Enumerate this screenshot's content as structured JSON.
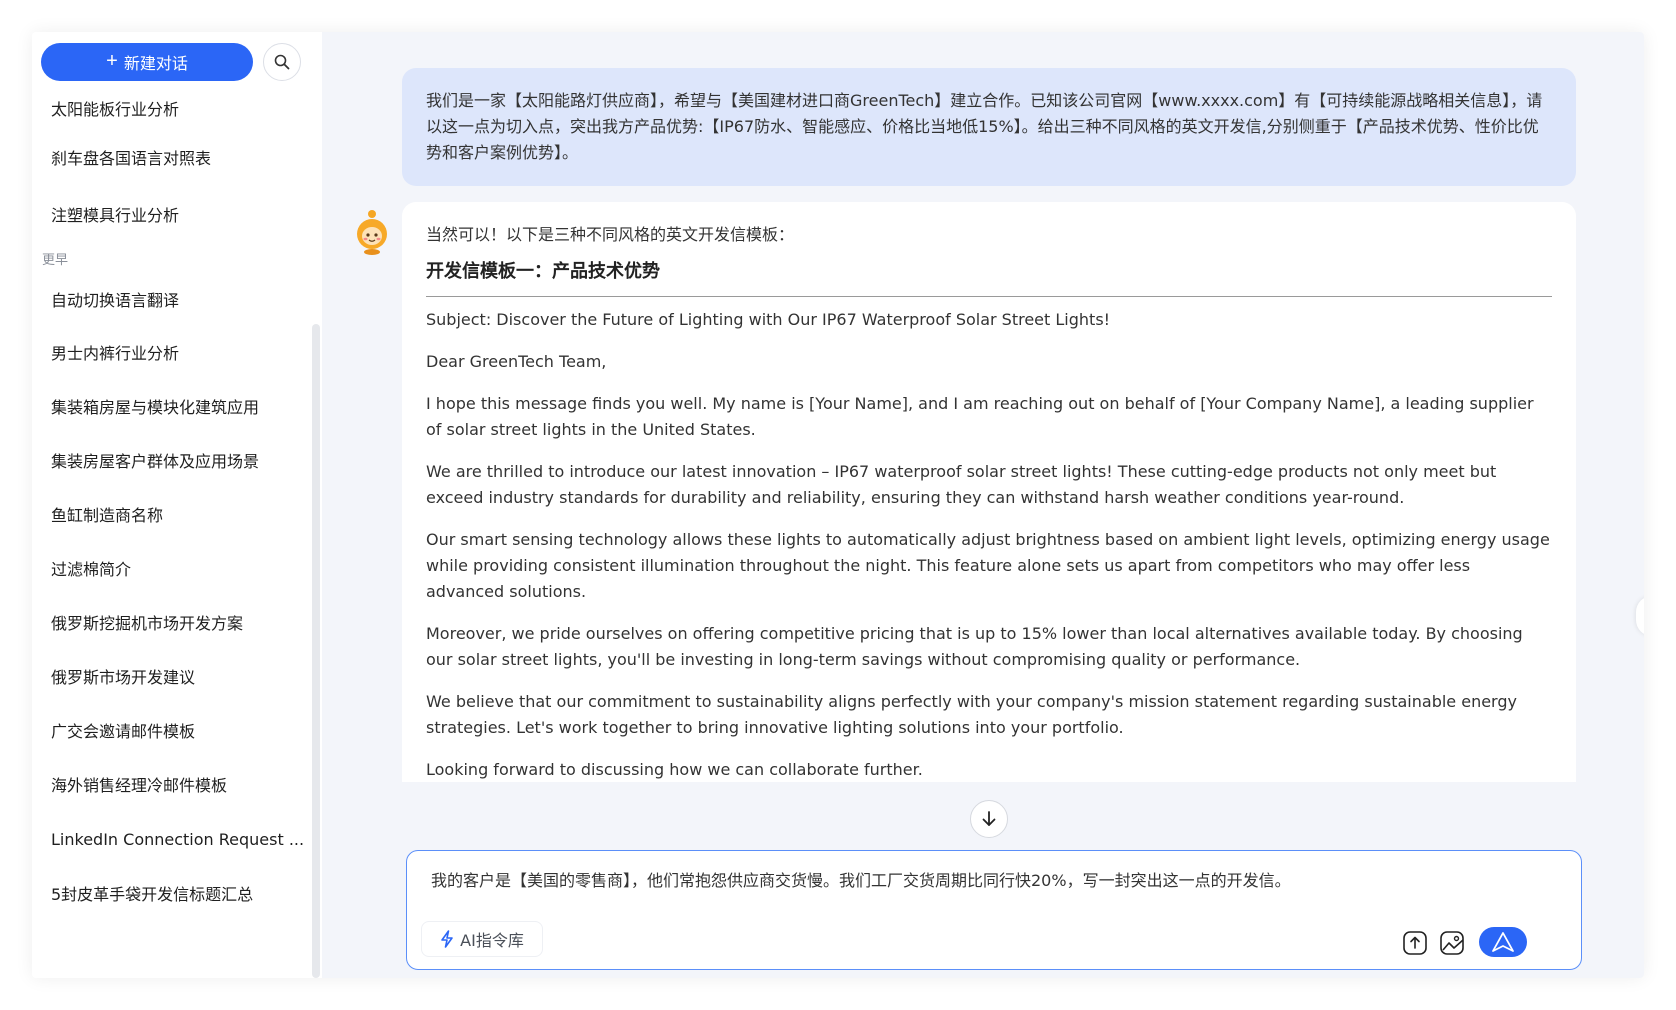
{
  "sidebar": {
    "new_chat_label": "新建对话",
    "recent_items": [
      "太阳能板行业分析",
      "刹车盘各国语言对照表",
      "注塑模具行业分析"
    ],
    "group_label": "更早",
    "older_items": [
      "自动切换语言翻译",
      "男士内裤行业分析",
      "集装箱房屋与模块化建筑应用",
      "集装房屋客户群体及应用场景",
      "鱼缸制造商名称",
      "过滤棉简介",
      "俄罗斯挖掘机市场开发方案",
      "俄罗斯市场开发建议",
      "广交会邀请邮件模板",
      "海外销售经理冷邮件模板",
      "LinkedIn Connection Request ...",
      "5封皮革手袋开发信标题汇总"
    ]
  },
  "chat": {
    "user_message": "我们是一家【太阳能路灯供应商】，希望与【美国建材进口商GreenTech】建立合作。已知该公司官网【www.xxxx.com】有【可持续能源战略相关信息】，请以这一点为切入点，突出我方产品优势:【IP67防水、智能感应、价格比当地低15%】。给出三种不同风格的英文开发信,分别侧重于【产品技术优势、性价比优势和客户案例优势】。",
    "ai_intro": "当然可以！以下是三种不同风格的英文开发信模板：",
    "ai_heading": "开发信模板一：产品技术优势",
    "ai_paragraphs": [
      "Subject: Discover the Future of Lighting with Our IP67 Waterproof Solar Street Lights!",
      "Dear GreenTech Team,",
      "I hope this message finds you well. My name is [Your Name], and I am reaching out on behalf of [Your Company Name], a leading supplier of solar street lights in the United States.",
      "We are thrilled to introduce our latest innovation – IP67 waterproof solar street lights! These cutting-edge products not only meet but exceed industry standards for durability and reliability, ensuring they can withstand harsh weather conditions year-round.",
      "Our smart sensing technology allows these lights to automatically adjust brightness based on ambient light levels, optimizing energy usage while providing consistent illumination throughout the night. This feature alone sets us apart from competitors who may offer less advanced solutions.",
      "Moreover, we pride ourselves on offering competitive pricing that is up to 15% lower than local alternatives available today. By choosing our solar street lights, you'll be investing in long-term savings without compromising quality or performance.",
      "We believe that our commitment to sustainability aligns perfectly with your company's mission statement regarding sustainable energy strategies. Let's work together to bring innovative lighting solutions into your portfolio.",
      "Looking forward to discussing how we can collaborate further."
    ]
  },
  "composer": {
    "input_value": "我的客户是【美国的零售商】，他们常抱怨供应商交货慢。我们工厂交货周期比同行快20%，写一封突出这一点的开发信。",
    "ai_prompt_label": "AI指令库"
  },
  "colors": {
    "accent": "#2b66f6",
    "user_bubble": "#dde6fb",
    "main_bg": "#f3f5fa"
  },
  "icons": [
    "plus-icon",
    "search-icon",
    "assistant-avatar-icon",
    "arrow-down-icon",
    "lightning-icon",
    "upload-icon",
    "image-icon",
    "send-icon"
  ]
}
